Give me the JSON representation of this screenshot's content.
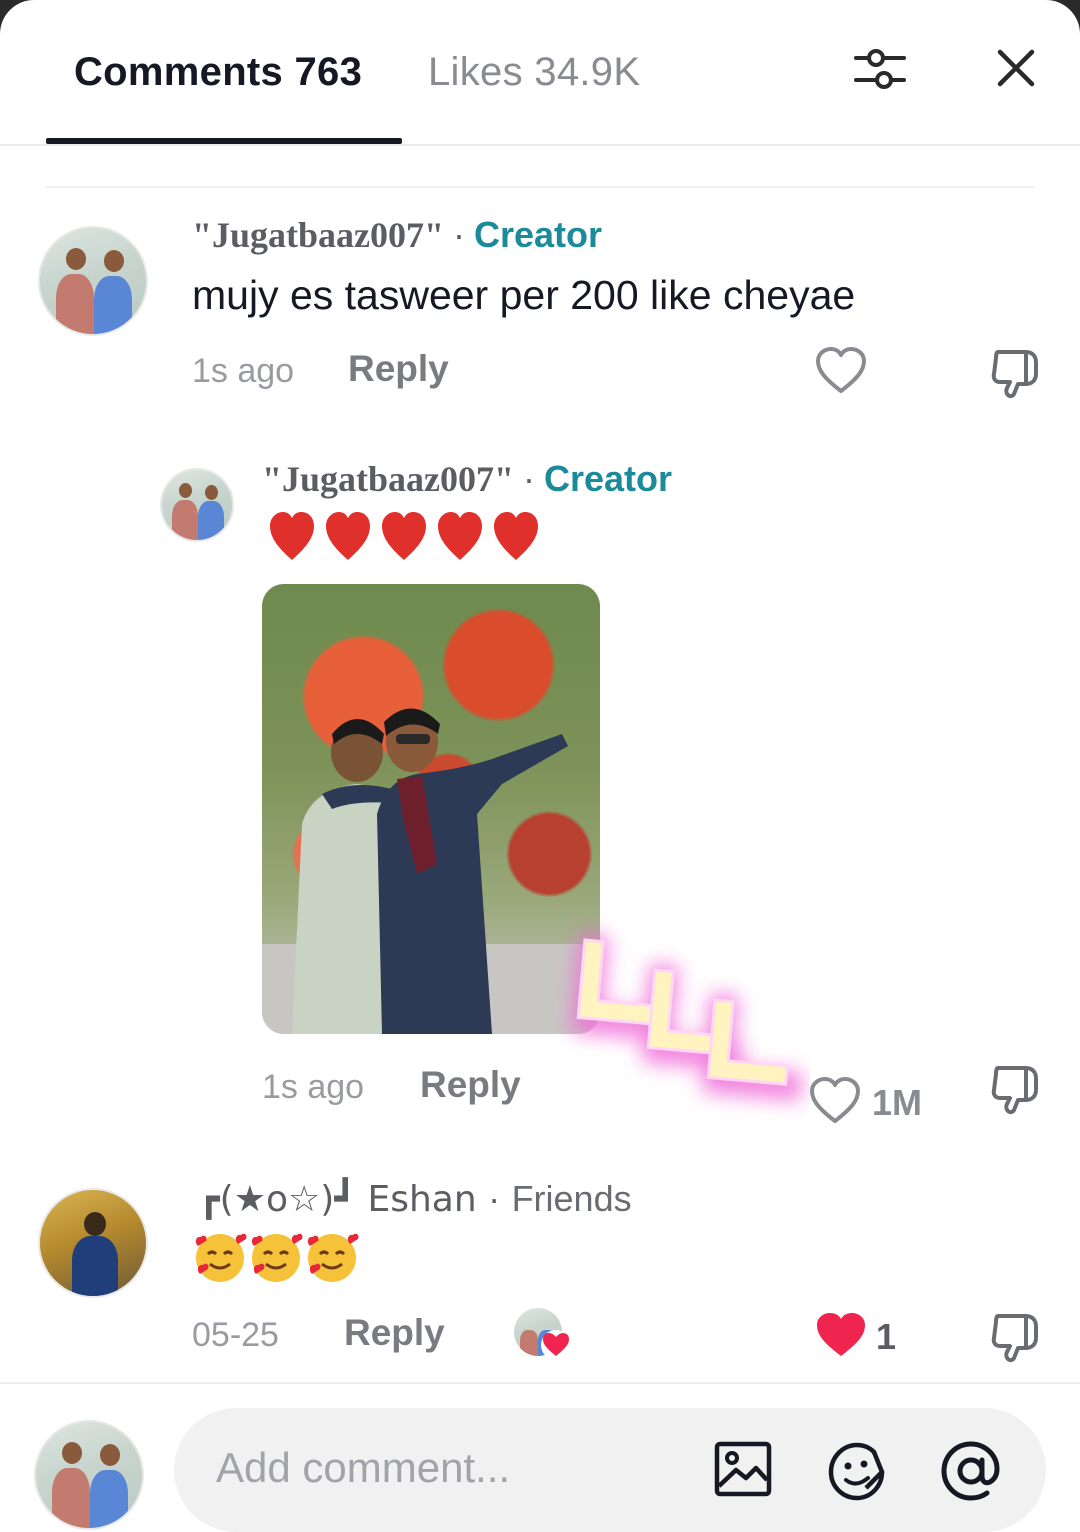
{
  "header": {
    "comments_tab": "Comments 763",
    "likes_tab": "Likes 34.9K",
    "filter_icon": "sliders-icon",
    "close_icon": "close-icon"
  },
  "comments": [
    {
      "username": "\"Jugatbaaz007\"",
      "separator": "·",
      "badge": "Creator",
      "text": "mujy es tasweer per 200 like cheyae",
      "time": "1s ago",
      "reply_label": "Reply"
    },
    {
      "username": "\"Jugatbaaz007\"",
      "separator": "·",
      "badge": "Creator",
      "text": "❤️❤️❤️❤️❤️",
      "time": "1s ago",
      "reply_label": "Reply",
      "like_count": "1M"
    },
    {
      "username": "┏(★o☆)┛ Eshan",
      "separator": "·",
      "badge": "Friends",
      "text": "🥰🥰🥰",
      "time": "05-25",
      "reply_label": "Reply",
      "like_count": "1"
    }
  ],
  "footer": {
    "input_placeholder": "Add comment...",
    "image_icon": "image-icon",
    "emoji_icon": "emoji-icon",
    "mention_icon": "at-icon"
  },
  "colors": {
    "accent_creator": "#1b8a9a",
    "liked_heart": "#f0254f"
  }
}
